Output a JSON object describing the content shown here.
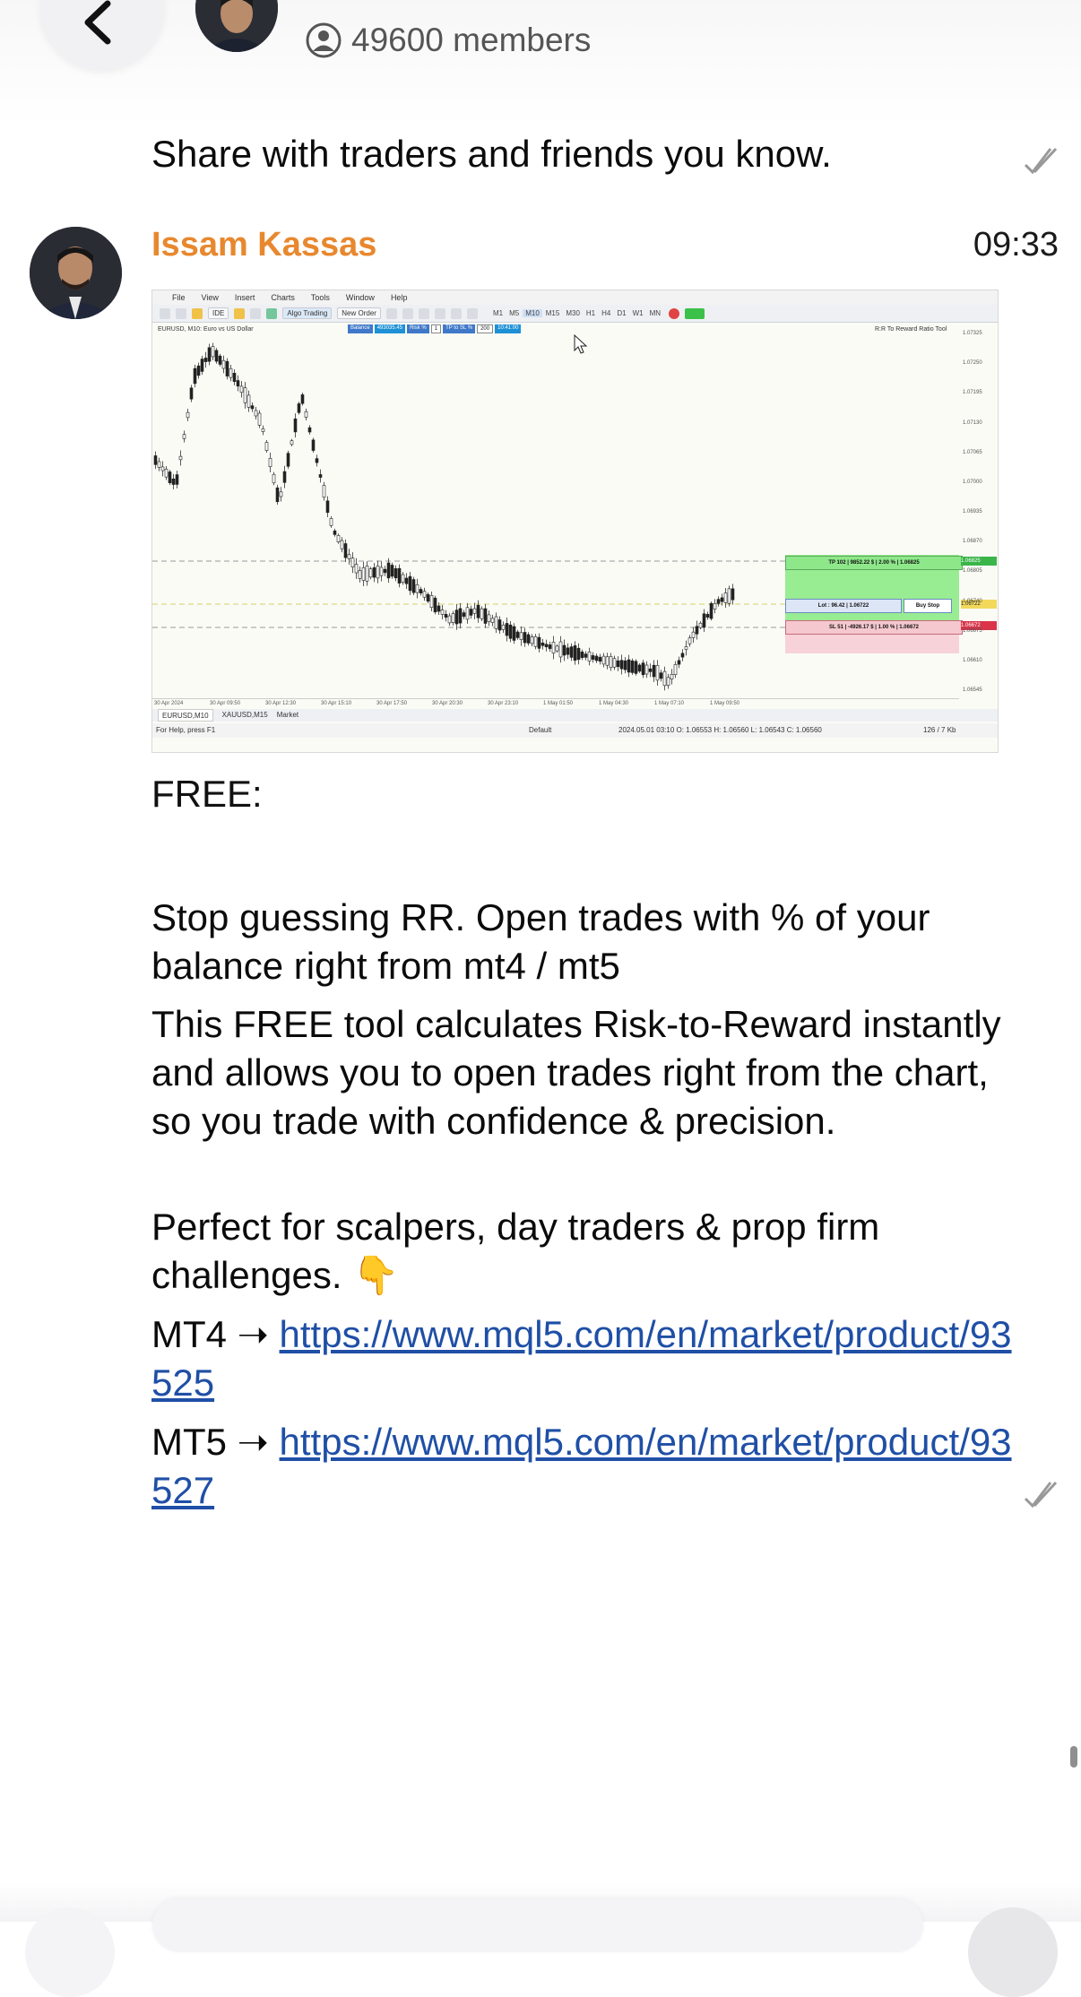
{
  "header": {
    "members_text": "49600 members"
  },
  "messages": [
    {
      "text": "Share with traders and friends you know."
    },
    {
      "sender": "Issam Kassas",
      "time": "09:33",
      "free_label": "FREE:",
      "para1": "Stop guessing RR. Open trades with % of your balance right from mt4 / mt5",
      "para2": " This FREE tool calculates Risk-to-Reward instantly and allows you to open trades right from the chart, so you trade with confidence & precision.",
      "para3": " Perfect for scalpers, day traders & prop firm challenges. 👇",
      "mt4_prefix": "MT4 ➝ ",
      "mt4_url": "https://www.mql5.com/en/market/product/93525",
      "mt5_prefix": " MT5 ➝ ",
      "mt5_url": "https://www.mql5.com/en/market/product/93527"
    }
  ],
  "screenshot": {
    "menu": [
      "File",
      "View",
      "Insert",
      "Charts",
      "Tools",
      "Window",
      "Help"
    ],
    "toolbar": {
      "ide": "IDE",
      "algo": "Algo Trading",
      "new_order": "New Order"
    },
    "timeframes": [
      "M1",
      "M5",
      "M10",
      "M15",
      "M30",
      "H1",
      "H4",
      "D1",
      "W1",
      "MN"
    ],
    "active_timeframe": "M10",
    "chart_title": "EURUSD, M10: Euro vs US Dollar",
    "tool_title": "R:R To Reward Ratio Tool",
    "panel": {
      "balance_label": "Balance",
      "balance_value": "493035.45",
      "risk_label": "Risk %",
      "risk_value": "1",
      "tp_sl_label": "TP to SL %",
      "tp_sl_value": "200",
      "time_value": "10:41:00"
    },
    "tp_label": "TP 102 | 9852.22 $ | 2.00 % | 1.06825",
    "entry_label": "Lot : 96.42 | 1.06722",
    "buy_stop": "Buy Stop",
    "sl_label": "SL 51 | -4926.17 $ | 1.00 % | 1.06672",
    "price_ticks": [
      "1.07325",
      "1.07250",
      "1.07195",
      "1.07130",
      "1.07065",
      "1.07000",
      "1.06935",
      "1.06870",
      "1.06805",
      "1.06740",
      "1.06675",
      "1.06610",
      "1.06545"
    ],
    "time_ticks": [
      "30 Apr 2024",
      "30 Apr 09:50",
      "30 Apr 12:30",
      "30 Apr 15:10",
      "30 Apr 17:50",
      "30 Apr 20:30",
      "30 Apr 23:10",
      "1 May 01:50",
      "1 May 04:30",
      "1 May 07:10",
      "1 May 09:50"
    ],
    "tabs": [
      "EURUSD,M10",
      "XAUUSD,M15",
      "Market"
    ],
    "status_help": "For Help, press F1",
    "status_default": "Default",
    "status_ohlc": "2024.05.01 03:10   O: 1.06553   H: 1.06560   L: 1.06543   C: 1.06560",
    "status_kb": "126 / 7 Kb",
    "price_badges": {
      "tp": "1.06825",
      "entry": "1.06722",
      "sl": "1.06672"
    }
  },
  "colors": {
    "sender": "#e8882e",
    "link": "#1f4fa6",
    "tp_zone": "#8ee88a",
    "sl_zone": "#f5c8cf",
    "accent": "#1e90d6"
  },
  "icons": {
    "back": "chevron-left-icon",
    "members": "user-circle-icon",
    "check": "double-check-icon"
  }
}
